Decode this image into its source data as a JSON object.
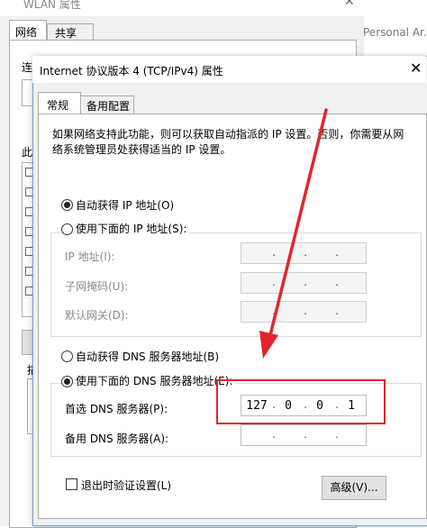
{
  "background_window": {
    "title": "WLAN 属性",
    "tabs": [
      {
        "label": "网络"
      },
      {
        "label": "共享"
      }
    ],
    "partial_labels": [
      "连",
      "此",
      "描"
    ]
  },
  "right_strip": {
    "text": "Personal Ar..."
  },
  "dialog": {
    "title": "Internet 协议版本 4 (TCP/IPv4) 属性",
    "close_glyph": "✕",
    "tabs": [
      {
        "label": "常规"
      },
      {
        "label": "备用配置"
      }
    ],
    "description": [
      "如果网络支持此功能，则可以获取自动指派的 IP 设置。否则，你需要从网",
      "络系统管理员处获得适当的 IP 设置。"
    ],
    "ip": {
      "auto_label": "自动获得 IP 地址(O)",
      "manual_label": "使用下面的 IP 地址(S):",
      "auto_selected": true,
      "fields": [
        {
          "label": "IP 地址(I):",
          "value": [
            "",
            "",
            "",
            ""
          ]
        },
        {
          "label": "子网掩码(U):",
          "value": [
            "",
            "",
            "",
            ""
          ]
        },
        {
          "label": "默认网关(D):",
          "value": [
            "",
            "",
            "",
            ""
          ]
        }
      ]
    },
    "dns": {
      "auto_label": "自动获得 DNS 服务器地址(B)",
      "manual_label": "使用下面的 DNS 服务器地址(E):",
      "manual_selected": true,
      "preferred_label": "首选 DNS 服务器(P):",
      "preferred_value": [
        "127",
        "0",
        "0",
        "1"
      ],
      "alternate_label": "备用 DNS 服务器(A):",
      "alternate_value": [
        "",
        "",
        "",
        ""
      ]
    },
    "validate_label": "退出时验证设置(L)",
    "validate_checked": false,
    "advanced_button": "高级(V)..."
  },
  "colors": {
    "highlight": "#e0262c",
    "accent": "#7a9ccf"
  }
}
